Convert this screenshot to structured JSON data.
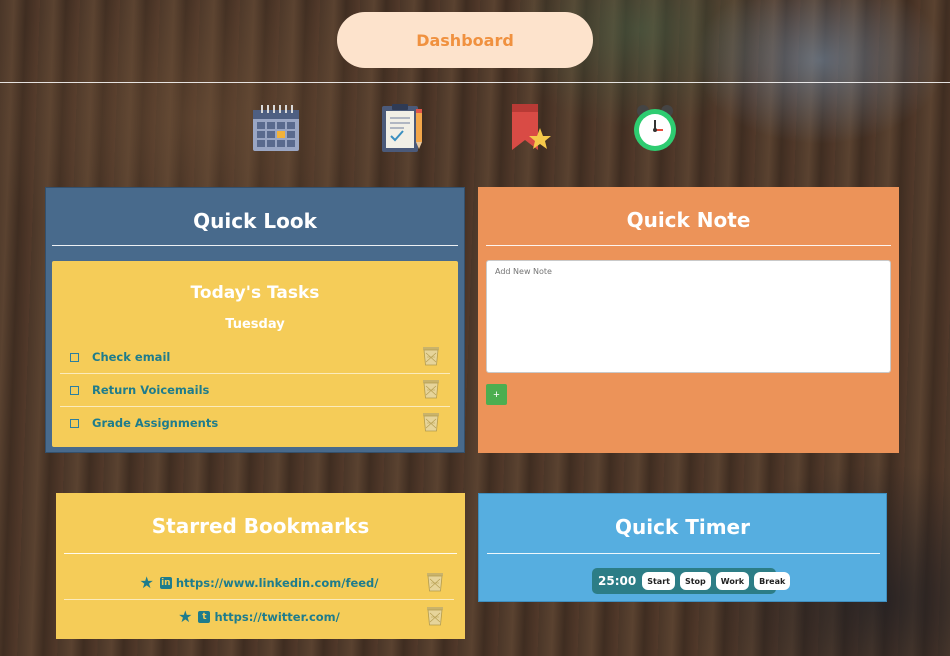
{
  "header": {
    "dashboard_label": "Dashboard"
  },
  "nav_icons": [
    "calendar-icon",
    "clipboard-icon",
    "bookmark-star-icon",
    "alarm-clock-icon"
  ],
  "quick_look": {
    "title": "Quick Look",
    "tasks": {
      "title": "Today's Tasks",
      "day": "Tuesday",
      "items": [
        {
          "label": "Check email"
        },
        {
          "label": "Return Voicemails"
        },
        {
          "label": "Grade Assignments"
        }
      ]
    }
  },
  "quick_note": {
    "title": "Quick Note",
    "placeholder": "Add New Note",
    "add_label": "+"
  },
  "bookmarks": {
    "title": "Starred Bookmarks",
    "items": [
      {
        "url": "https://www.linkedin.com/feed/",
        "social_icon": "linkedin-icon"
      },
      {
        "url": "https://twitter.com/",
        "social_icon": "twitter-icon"
      }
    ]
  },
  "timer": {
    "title": "Quick Timer",
    "value": "25:00",
    "start_label": "Start",
    "stop_label": "Stop",
    "work_label": "Work",
    "break_label": "Break"
  },
  "colors": {
    "quick_look_bg": "#486a8c",
    "quick_note_bg": "#ec9359",
    "bookmarks_bg": "#f5cc58",
    "timer_bg": "#56aee0",
    "dashboard_text": "#f0913f",
    "teal_text": "#1e7c8c"
  }
}
